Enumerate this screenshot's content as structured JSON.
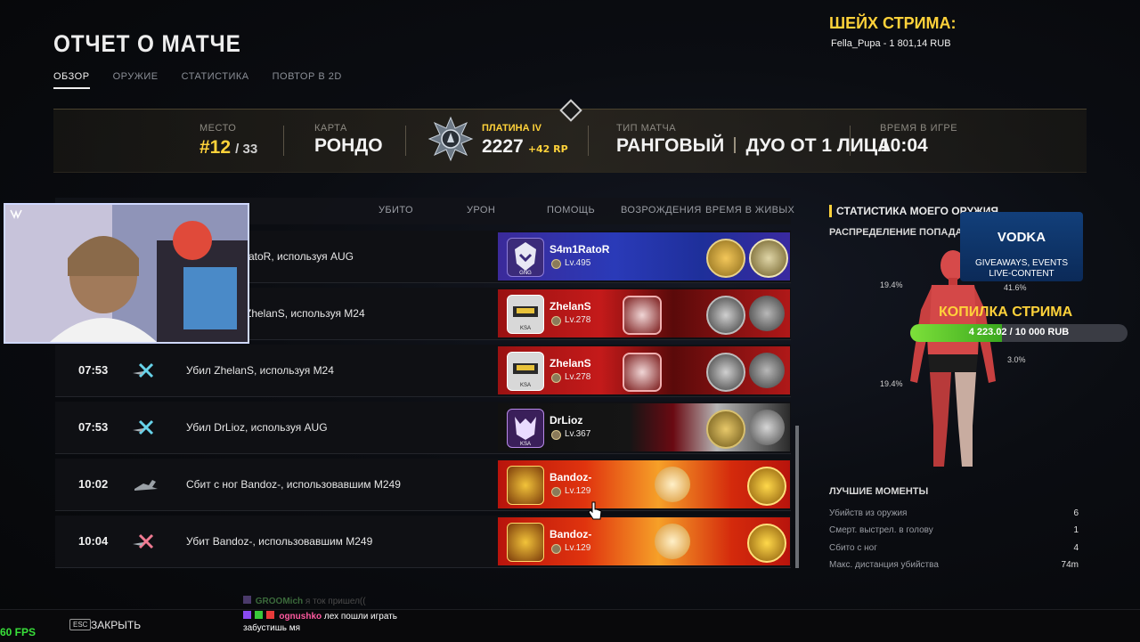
{
  "header": {
    "title": "ОТЧЕТ О МАТЧЕ",
    "tabs": [
      "ОБЗОР",
      "ОРУЖИЕ",
      "СТАТИСТИКА",
      "ПОВТОР В 2D"
    ],
    "active_tab": "ОБЗОР"
  },
  "sheikh": {
    "title": "ШЕЙХ СТРИМА:",
    "line": "Fella_Pupa - 1 801,14 RUB"
  },
  "summary": {
    "place_label": "МЕСТО",
    "place": "#12",
    "place_total": "/ 33",
    "map_label": "КАРТА",
    "map": "РОНДО",
    "rank_name": "ПЛАТИНА IV",
    "rank_points": "2227",
    "rank_delta": "+42 RP",
    "match_type_label": "ТИП МАТЧА",
    "match_type": "РАНГОВЫЙ",
    "match_mode": "ДУО ОТ 1 ЛИЦА",
    "time_label": "ВРЕМЯ В ИГРЕ",
    "time": "10:04"
  },
  "table": {
    "columns": [
      "УБИТО",
      "УРОН",
      "ПОМОЩЬ",
      "ВОЗРОЖДЕНИЯ",
      "ВРЕМЯ В ЖИВЫХ"
    ],
    "rows": [
      {
        "time": "",
        "action": "kill",
        "desc": "ratoR, используя AUG",
        "player": "S4m1RatoR",
        "level": "Lv.495",
        "clan": "GNG"
      },
      {
        "time": "",
        "action": "kill",
        "desc": "ZhelanS, используя M24",
        "player": "ZhelanS",
        "level": "Lv.278",
        "clan": "KSA"
      },
      {
        "time": "07:53",
        "action": "kill",
        "desc": "Убил ZhelanS, используя M24",
        "player": "ZhelanS",
        "level": "Lv.278",
        "clan": "KSA"
      },
      {
        "time": "07:53",
        "action": "kill",
        "desc": "Убил DrLioz, используя AUG",
        "player": "DrLioz",
        "level": "Lv.367",
        "clan": "KSA"
      },
      {
        "time": "10:02",
        "action": "knocked",
        "desc": "Сбит с ног Bandoz-, использовавшим M249",
        "player": "Bandoz-",
        "level": "Lv.129",
        "clan": ""
      },
      {
        "time": "10:04",
        "action": "killed",
        "desc": "Убит Bandoz-, использовавшим M249",
        "player": "Bandoz-",
        "level": "Lv.129",
        "clan": ""
      }
    ]
  },
  "weapon_panel": {
    "title": "СТАТИСТИКА МОЕГО ОРУЖИЯ",
    "hit_distribution_label": "РАСПРЕДЕЛЕНИЕ ПОПАДАНИЙ",
    "hits": {
      "head": "41.6%",
      "left_arm": "19.4%",
      "right_leg": "3.0%",
      "left_leg": "19.4%"
    }
  },
  "best_moments": {
    "title": "ЛУЧШИЕ МОМЕНТЫ",
    "items": [
      {
        "label": "Убийств из оружия",
        "value": "6"
      },
      {
        "label": "Смерт. выстрел. в голову",
        "value": "1"
      },
      {
        "label": "Сбито с ног",
        "value": "4"
      },
      {
        "label": "Макс. дистанция убийства",
        "value": "74m"
      }
    ]
  },
  "vodka": {
    "logo": "VODKA",
    "line1": "GIVEAWAYS, EVENTS",
    "line2": "LIVE-CONTENT"
  },
  "kopilka": {
    "title": "КОПИЛКА СТРИМА",
    "text": "4 223.02 / 10 000 RUB",
    "progress": 0.4223
  },
  "bottom": {
    "fps": "60 FPS",
    "esc": "ESC",
    "close": "ЗАКРЫТЬ"
  },
  "chat": [
    {
      "user": "GROOMich",
      "text": "я ток пришел((",
      "color": "#3b8a3b"
    },
    {
      "user": "ognushko",
      "text": "лех пошли играть",
      "color": "#ff5aa0"
    },
    {
      "user": "",
      "text": "забустишь мя",
      "color": "#ffffff"
    }
  ],
  "colors": {
    "accent": "#ffd23a",
    "fps": "#39e03a",
    "kopilka_fill": "#5bc82a"
  }
}
